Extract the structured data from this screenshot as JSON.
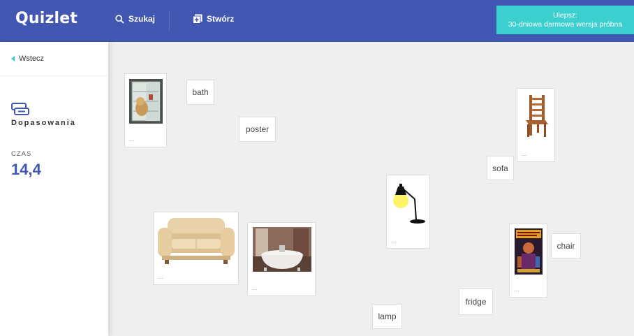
{
  "header": {
    "logo": "Quizlet",
    "search_label": "Szukaj",
    "create_label": "Stwórz",
    "upgrade_line1": "Ulepsz:",
    "upgrade_line2": "30-dniowa darmowa wersja próbna"
  },
  "sidebar": {
    "back_label": "Wstecz",
    "mode_label": "Dopasowania",
    "time_label": "CZAS",
    "time_value": "14,4"
  },
  "board": {
    "words": {
      "bath": "bath",
      "poster": "poster",
      "sofa": "sofa",
      "chair": "chair",
      "fridge": "fridge",
      "lamp": "lamp"
    },
    "card_dots": "..."
  },
  "colors": {
    "header_bg": "#4257b2",
    "upgrade_bg": "#3ccfcf",
    "time_accent": "#4257b2"
  }
}
